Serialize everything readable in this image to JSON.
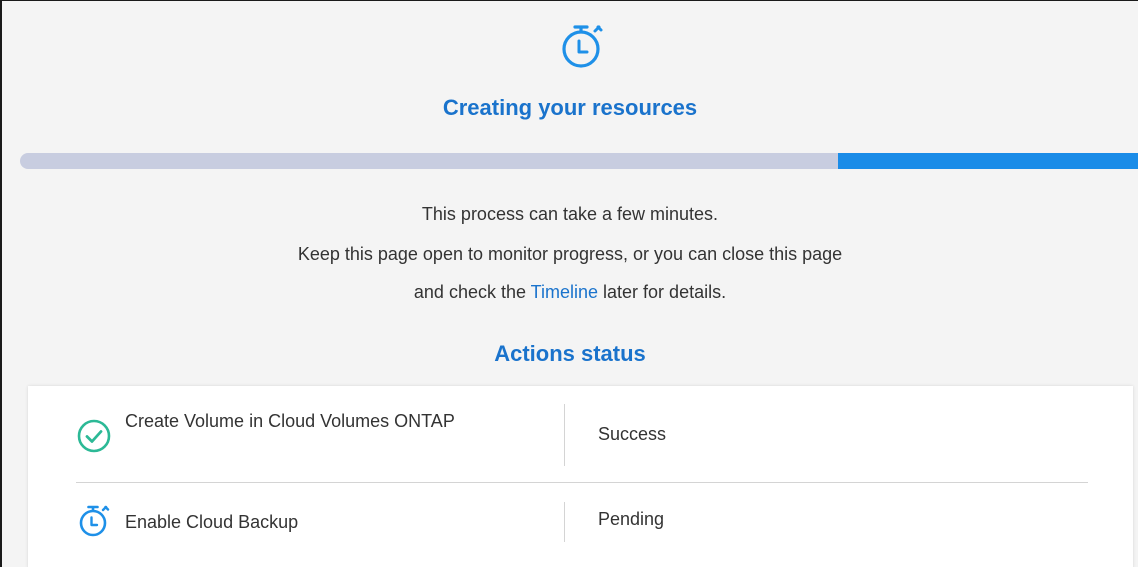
{
  "header": {
    "title": "Creating your resources",
    "icon": "stopwatch-icon"
  },
  "progress": {
    "percent": 27
  },
  "description": {
    "line1": "This process can take a few minutes.",
    "line2": "Keep this page open to monitor progress, or you can close this page",
    "line3_before": "and check the ",
    "line3_link": "Timeline",
    "line3_after": " later for details."
  },
  "actions": {
    "title": "Actions status",
    "rows": [
      {
        "label": "Create Volume in Cloud Volumes ONTAP",
        "status": "Success",
        "icon": "check-circle-icon"
      },
      {
        "label": "Enable Cloud Backup",
        "status": "Pending",
        "icon": "stopwatch-icon"
      }
    ]
  },
  "colors": {
    "accent": "#1a73cc",
    "progress_fill": "#1a8ce8",
    "progress_track": "#c8cde0",
    "success": "#2cb996",
    "pending": "#1e90e8"
  }
}
